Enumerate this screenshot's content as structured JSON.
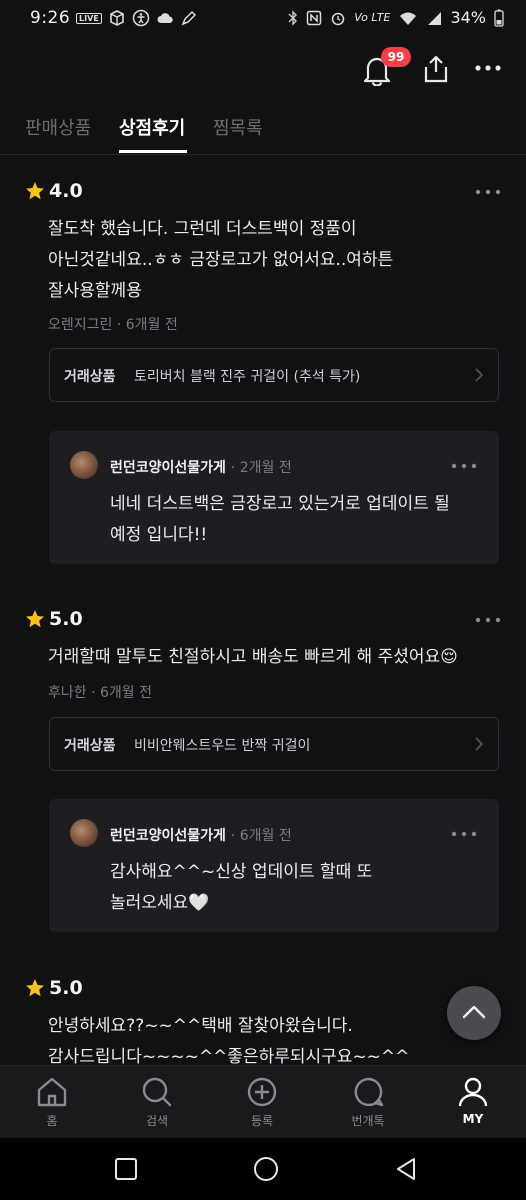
{
  "status_bar": {
    "time": "9:26",
    "live_badge": "LIVE",
    "battery": "34%",
    "network": "Vo LTE"
  },
  "header": {
    "notification_count": "99",
    "icons": [
      "bell-icon",
      "share-icon",
      "more-icon"
    ]
  },
  "tabs": [
    {
      "label": "판매상품",
      "active": false
    },
    {
      "label": "상점후기",
      "active": true
    },
    {
      "label": "찜목록",
      "active": false
    }
  ],
  "reviews": [
    {
      "rating": "4.0",
      "lines": [
        "잘도착 했습니다. 그런데 더스트백이 정품이",
        "아닌것같네요..ㅎㅎ 금장로고가 없어서요..여하튼",
        "잘사용할께용"
      ],
      "meta": "오렌지그린 · 6개월 전",
      "product_label": "거래상품",
      "product_name": "토리버치 블랙 진주 귀걸이 (추석 특가)",
      "reply": {
        "seller": "런던코양이선물가게",
        "time": "· 2개월 전",
        "lines": [
          "네네 더스트백은 금장로고 있는거로 업데이트 될",
          "예정 입니다!!"
        ]
      }
    },
    {
      "rating": "5.0",
      "lines": [
        "거래할때 말투도 친절하시고 배송도 빠르게 해 주셨어요😌"
      ],
      "meta": "후나한 · 6개월 전",
      "product_label": "거래상품",
      "product_name": "비비안웨스트우드 반짝 귀걸이",
      "reply": {
        "seller": "런던코양이선물가게",
        "time": "· 6개월 전",
        "lines": [
          "감사해요^^~신상 업데이트 할때 또",
          "놀러오세요🤍"
        ]
      }
    },
    {
      "rating": "5.0",
      "lines": [
        "안녕하세요??~~^^택배 잘찾아왔습니다.",
        "감사드립니다~~~~^^좋은하루되시구요~~^^"
      ]
    }
  ],
  "bottom_nav": [
    {
      "label": "홈",
      "icon": "home-icon",
      "active": false
    },
    {
      "label": "검색",
      "icon": "search-icon",
      "active": false
    },
    {
      "label": "등록",
      "icon": "add-circle-icon",
      "active": false
    },
    {
      "label": "번개톡",
      "icon": "chat-icon",
      "active": false
    },
    {
      "label": "MY",
      "icon": "profile-icon",
      "active": true
    }
  ]
}
